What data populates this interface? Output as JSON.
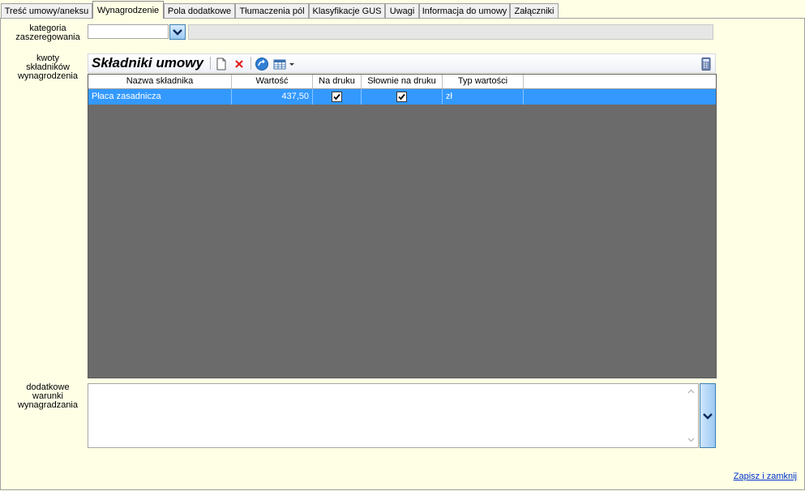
{
  "tabs": [
    {
      "label": "Treść umowy/aneksu"
    },
    {
      "label": "Wynagrodzenie"
    },
    {
      "label": "Pola dodatkowe"
    },
    {
      "label": "Tłumaczenia pól"
    },
    {
      "label": "Klasyfikacje GUS"
    },
    {
      "label": "Uwagi"
    },
    {
      "label": "Informacja do umowy"
    },
    {
      "label": "Załączniki"
    }
  ],
  "active_tab": "Wynagrodzenie",
  "category": {
    "label_line1": "kategoria",
    "label_line2": "zaszeregowania",
    "value": "",
    "description": ""
  },
  "components": {
    "label_line1": "kwoty",
    "label_line2": "składników",
    "label_line3": "wynagrodzenia",
    "panel_title": "Składniki umowy",
    "toolbar_icons": [
      "new-document-icon",
      "delete-icon",
      "refresh-icon",
      "grid-view-icon",
      "dropdown-arrow-icon",
      "calculator-icon"
    ],
    "columns": [
      "Nazwa składnika",
      "Wartość",
      "Na druku",
      "Słownie na druku",
      "Typ wartości"
    ],
    "rows": [
      {
        "name": "Płaca zasadnicza",
        "value": "437,50",
        "on_print": true,
        "in_words_on_print": true,
        "value_type": "zł"
      }
    ]
  },
  "additional_terms": {
    "label_line1": "dodatkowe",
    "label_line2": "warunki",
    "label_line3": "wynagradzania",
    "value": ""
  },
  "footer": {
    "save_close_label": "Zapisz i zamknij"
  },
  "colors": {
    "background": "#ffffe6",
    "selection": "#3399ff",
    "grid_empty": "#6b6b6b",
    "link": "#0033cc"
  }
}
